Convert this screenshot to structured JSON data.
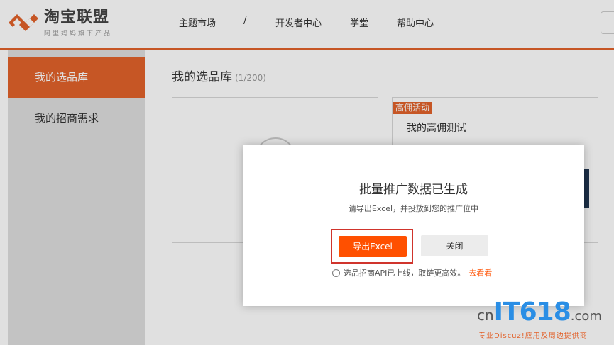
{
  "header": {
    "logo_title": "淘宝联盟",
    "logo_sub": "阿里妈妈旗下产品",
    "nav": [
      "主题市场",
      "/",
      "开发者中心",
      "学堂",
      "帮助中心"
    ]
  },
  "sidebar": {
    "items": [
      {
        "label": "我的选品库",
        "active": true
      },
      {
        "label": "我的招商需求",
        "active": false
      }
    ]
  },
  "main": {
    "title": "我的选品库",
    "count": "(1/200)",
    "card2": {
      "tag": "高佣活动",
      "title": "我的高佣测试"
    }
  },
  "dialog": {
    "title": "批量推广数据已生成",
    "subtitle": "请导出Excel，并投放到您的推广位中",
    "export_label": "导出Excel",
    "close_label": "关闭",
    "note": "选品招商API已上线，取链更高效。",
    "note_link": "去看看"
  },
  "watermark": {
    "cn": "cn",
    "it": "IT618",
    "com": ".com",
    "sub": "专业Discuz!应用及周边提供商"
  },
  "colors": {
    "accent": "#e2622b",
    "button": "#ff5000",
    "highlight_border": "#d0342c"
  }
}
